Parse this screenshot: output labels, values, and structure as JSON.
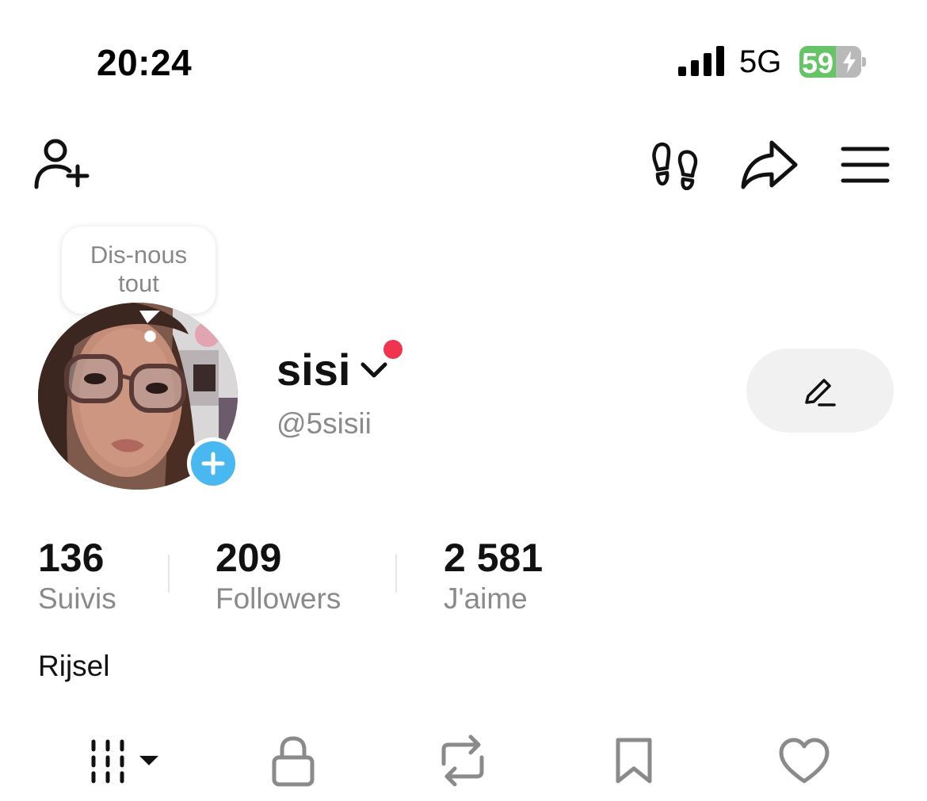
{
  "status_bar": {
    "time": "20:24",
    "network": "5G",
    "battery_percent": "59",
    "battery_level": 0.59,
    "battery_charging": true,
    "battery_color": "#65c466",
    "signal_icon": "cellular-signal-icon"
  },
  "top_bar": {
    "icons": [
      "add-friend-icon",
      "footprints-icon",
      "share-icon",
      "menu-icon"
    ]
  },
  "tooltip": {
    "line1": "Dis-nous",
    "line2": "tout"
  },
  "profile": {
    "name": "sisi",
    "handle": "@5sisii",
    "bio": "Rijsel",
    "notification_dot_color": "#f0334f",
    "avatar_add_color": "#49b8f0"
  },
  "stats": {
    "following": {
      "value": "136",
      "label": "Suivis"
    },
    "followers": {
      "value": "209",
      "label": "Followers"
    },
    "likes": {
      "value": "2 581",
      "label": "J'aime"
    }
  },
  "tabs": [
    "videos-grid-icon",
    "lock-icon",
    "repost-icon",
    "bookmark-icon",
    "heart-icon"
  ]
}
